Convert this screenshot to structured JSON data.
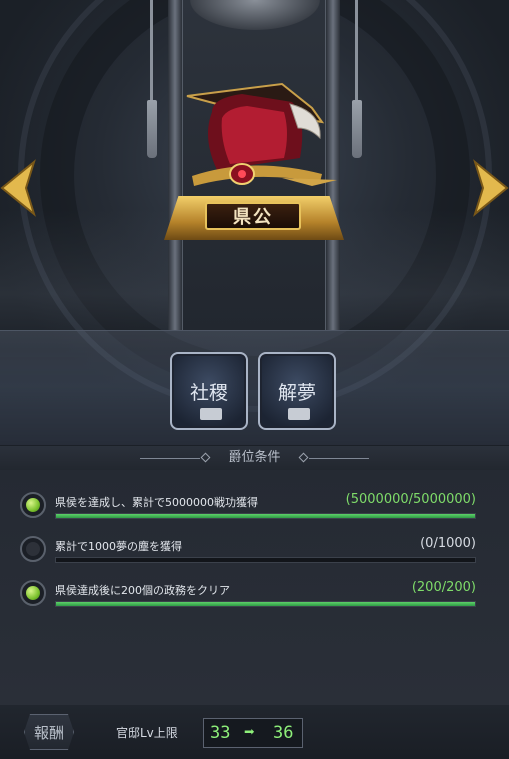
{
  "rank": {
    "title": "県公"
  },
  "buttons": {
    "shashoku": "社稷",
    "kaimu": "解夢"
  },
  "conditions_header": "爵位条件",
  "conditions": [
    {
      "text": "県侯を達成し、累計で5000000戦功獲得",
      "value": "(5000000/5000000)",
      "progress": 1.0,
      "completed": true
    },
    {
      "text": "累計で1000夢の塵を獲得",
      "value": "(0/1000)",
      "progress": 0.0,
      "completed": false
    },
    {
      "text": "県侯達成後に200個の政務をクリア",
      "value": "(200/200)",
      "progress": 1.0,
      "completed": true
    }
  ],
  "footer": {
    "reward_label": "報酬",
    "level_label": "官邸Lv上限",
    "level_from": "33",
    "level_arrow": "➡",
    "level_to": "36"
  },
  "colors": {
    "complete": "#7fdc6a",
    "bar_fill": "#3fb556",
    "gold": "#e7c25c"
  },
  "icons": {
    "left_arrow": "arrow-left-icon",
    "right_arrow": "arrow-right-icon",
    "hat": "official-hat-icon"
  }
}
